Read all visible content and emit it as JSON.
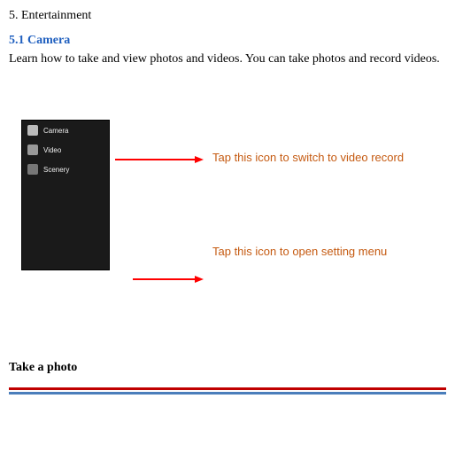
{
  "doc": {
    "section_number_title": "5. Entertainment",
    "subsection_number_title": "5.1 Camera",
    "intro_text": "Learn how to take and view photos and videos. You can take photos and record videos.",
    "take_photo_heading": "Take a photo"
  },
  "phone_menu": {
    "items": [
      {
        "label": "Camera"
      },
      {
        "label": "Video"
      },
      {
        "label": "Scenery"
      }
    ]
  },
  "callouts": {
    "video_switch": "Tap this icon to switch to video record",
    "settings_menu": "Tap this icon to open setting menu"
  }
}
